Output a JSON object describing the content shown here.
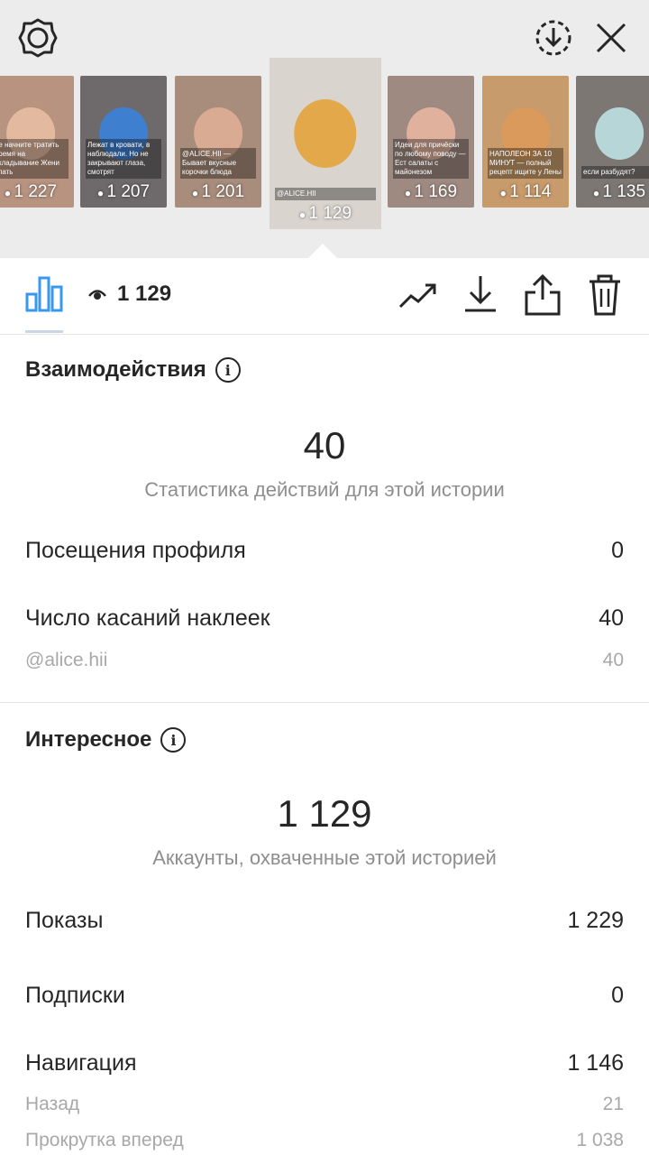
{
  "colors": {
    "accent": "#3897f0",
    "text": "#262626",
    "muted": "#8e8e8e",
    "top_bg": "#ececec"
  },
  "top_bar": {
    "left_icon": "settings-gear-icon",
    "download_icon": "download-circle-icon",
    "close_icon": "close-icon"
  },
  "thumbnails": [
    {
      "views": "1 227",
      "caption": "не начните тратить время на укладывание Жени спать",
      "bg": "#b89480",
      "face": "#e3b9a0"
    },
    {
      "views": "1 207",
      "caption": "Лежат в кровати, в наблюдали. Но не закрывают глаза, смотрят",
      "bg": "#6e6a6b",
      "face": "#3f7fd0"
    },
    {
      "views": "1 201",
      "caption": "@ALICE.HII — Бывает вкусные корочки блюда",
      "bg": "#a88c7c",
      "face": "#d9ab92"
    },
    {
      "views": "1 129",
      "caption": "@ALICE.HII",
      "bg": "#d9d4ce",
      "face": "#e3a84a",
      "selected": true
    },
    {
      "views": "1 169",
      "caption": "Идеи для причёски по любому поводу — Ест салаты с майонезом",
      "bg": "#9f8a82",
      "face": "#e0b29e"
    },
    {
      "views": "1 114",
      "caption": "НАПОЛЕОН ЗА 10 МИНУТ — полный рецепт ищите у Лены",
      "bg": "#c79b6b",
      "face": "#d99a5b"
    },
    {
      "views": "1 135",
      "caption": "если разбудят?",
      "bg": "#7c7773",
      "face": "#b7d6d8"
    }
  ],
  "toolbar": {
    "stats_icon": "bar-chart-icon",
    "views_count": "1 129",
    "promote_icon": "trending-up-icon",
    "save_icon": "download-icon",
    "share_icon": "share-icon",
    "delete_icon": "trash-icon"
  },
  "interactions": {
    "title": "Взаимодействия",
    "total": "40",
    "total_caption": "Статистика действий для этой истории",
    "profile_visits_label": "Посещения профиля",
    "profile_visits_value": "0",
    "sticker_taps_label": "Число касаний наклеек",
    "sticker_taps_value": "40",
    "sticker_mention_label": "@alice.hii",
    "sticker_mention_value": "40"
  },
  "discovery": {
    "title": "Интересное",
    "reach": "1 129",
    "reach_caption": "Аккаунты, охваченные этой историей",
    "impressions_label": "Показы",
    "impressions_value": "1 229",
    "follows_label": "Подписки",
    "follows_value": "0",
    "navigation_label": "Навигация",
    "navigation_value": "1 146",
    "back_label": "Назад",
    "back_value": "21",
    "forward_label": "Прокрутка вперед",
    "forward_value": "1 038"
  }
}
